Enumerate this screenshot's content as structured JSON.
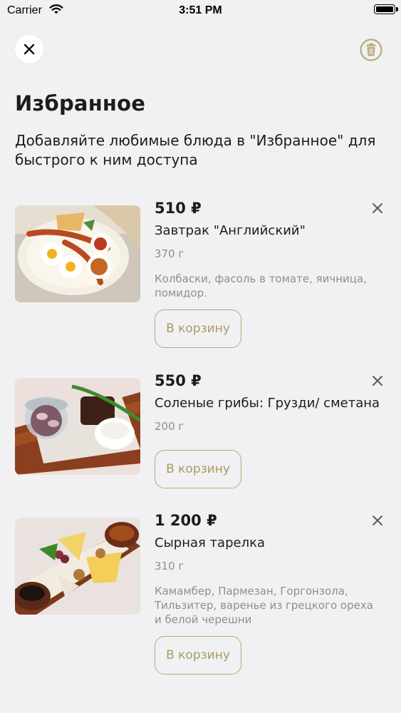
{
  "status_bar": {
    "carrier": "Carrier",
    "time": "3:51 PM"
  },
  "header": {
    "close_icon": "close-icon",
    "clear_icon": "trash-icon",
    "accent": "#a99a62"
  },
  "page": {
    "title": "Избранное",
    "subtitle": "Добавляйте любимые блюда в \"Избранное\" для быстрого к ним доступа"
  },
  "items": [
    {
      "price": "510 ₽",
      "name": "Завтрак \"Английский\"",
      "weight": "370 г",
      "description": "Колбаски, фасоль в томате, яичница, помидор.",
      "button": "В корзину"
    },
    {
      "price": "550 ₽",
      "name": "Соленые грибы: Грузди/ сметана",
      "weight": "200 г",
      "description": "",
      "button": "В корзину"
    },
    {
      "price": "1 200 ₽",
      "name": "Сырная тарелка",
      "weight": "310 г",
      "description": "Камамбер, Пармезан, Горгонзола, Тильзитер, варенье из грецкого ореха и белой черешни",
      "button": "В корзину"
    }
  ]
}
